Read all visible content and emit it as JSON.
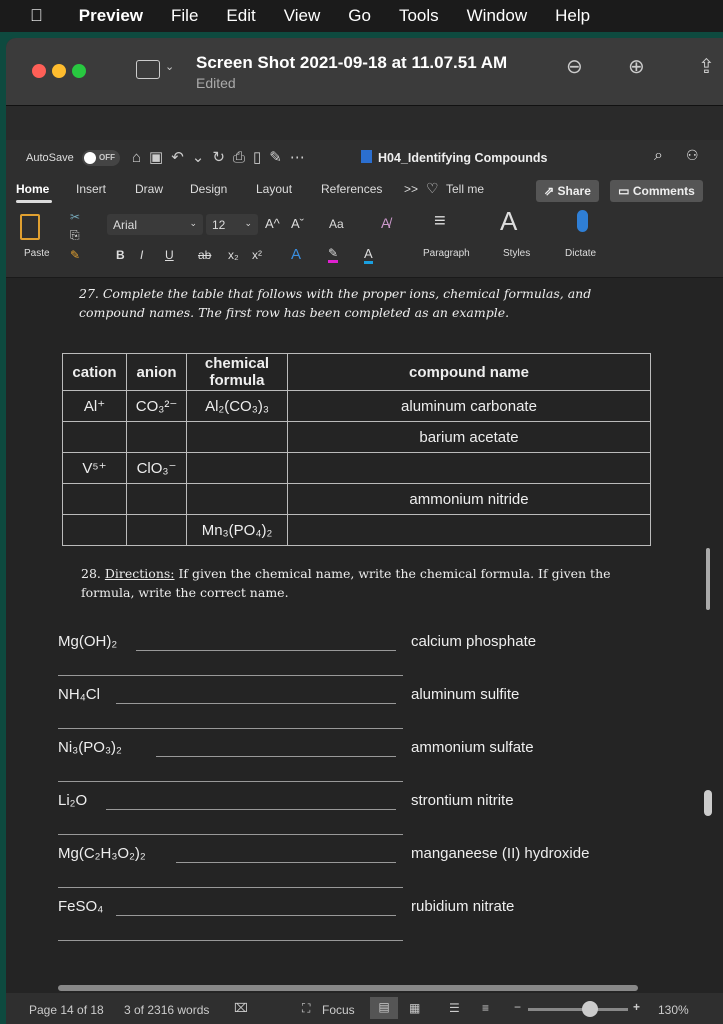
{
  "menubar": {
    "items": [
      "Preview",
      "File",
      "Edit",
      "View",
      "Go",
      "Tools",
      "Window",
      "Help"
    ]
  },
  "preview": {
    "title": "Screen Shot 2021-09-18 at 11.07.51 AM",
    "subtitle": "Edited"
  },
  "word": {
    "autosave": "AutoSave",
    "autosave_state": "OFF",
    "doc_title": "H04_Identifying Compounds",
    "tabs": [
      "Home",
      "Insert",
      "Draw",
      "Design",
      "Layout",
      "References"
    ],
    "more": ">>",
    "tell_me": "Tell me",
    "share": "Share",
    "comments": "Comments",
    "font": "Arial",
    "size": "12",
    "paste": "Paste",
    "paragraph": "Paragraph",
    "styles": "Styles",
    "dictate": "Dictate",
    "fmt": {
      "bold": "B",
      "italic": "I",
      "underline": "U",
      "strike": "ab",
      "sub": "x₂",
      "sup": "x²",
      "case": "Aa",
      "grow": "A^",
      "shrink": "Aˇ"
    },
    "colors": {
      "highlight": "#e020d0",
      "font": "#1aa0e0"
    }
  },
  "q27": {
    "text": "27. Complete the table that follows with the proper ions, chemical formulas, and compound names. The first row has been completed as an example.",
    "headers": [
      "cation",
      "anion",
      "chemical formula",
      "compound name"
    ],
    "rows": [
      [
        "Al⁺",
        "CO₃²⁻",
        "Al₂(CO₃)₃",
        "aluminum carbonate"
      ],
      [
        "",
        "",
        "",
        "barium acetate"
      ],
      [
        "V⁵⁺",
        "ClO₃⁻",
        "",
        ""
      ],
      [
        "",
        "",
        "",
        "ammonium nitride"
      ],
      [
        "",
        "",
        "Mn₃(PO₄)₂",
        ""
      ]
    ]
  },
  "q28": {
    "num": "28.",
    "directions": "Directions:",
    "text": " If given the chemical name, write the chemical formula. If given the formula, write the correct name.",
    "items": [
      {
        "left": "Mg(OH)₂",
        "right": "calcium phosphate"
      },
      {
        "left": "NH₄Cl",
        "right": "aluminum sulfite"
      },
      {
        "left": "Ni₃(PO₃)₂",
        "right": "ammonium sulfate"
      },
      {
        "left": "Li₂O",
        "right": "strontium nitrite"
      },
      {
        "left": "Mg(C₂H₃O₂)₂",
        "right": "manganeese (II) hydroxide"
      },
      {
        "left": "FeSO₄",
        "right": "rubidium nitrate"
      }
    ]
  },
  "status": {
    "page": "Page 14 of 18",
    "words": "3 of 2316 words",
    "focus": "Focus",
    "zoom": "130%",
    "zoom_level": 0.62
  }
}
